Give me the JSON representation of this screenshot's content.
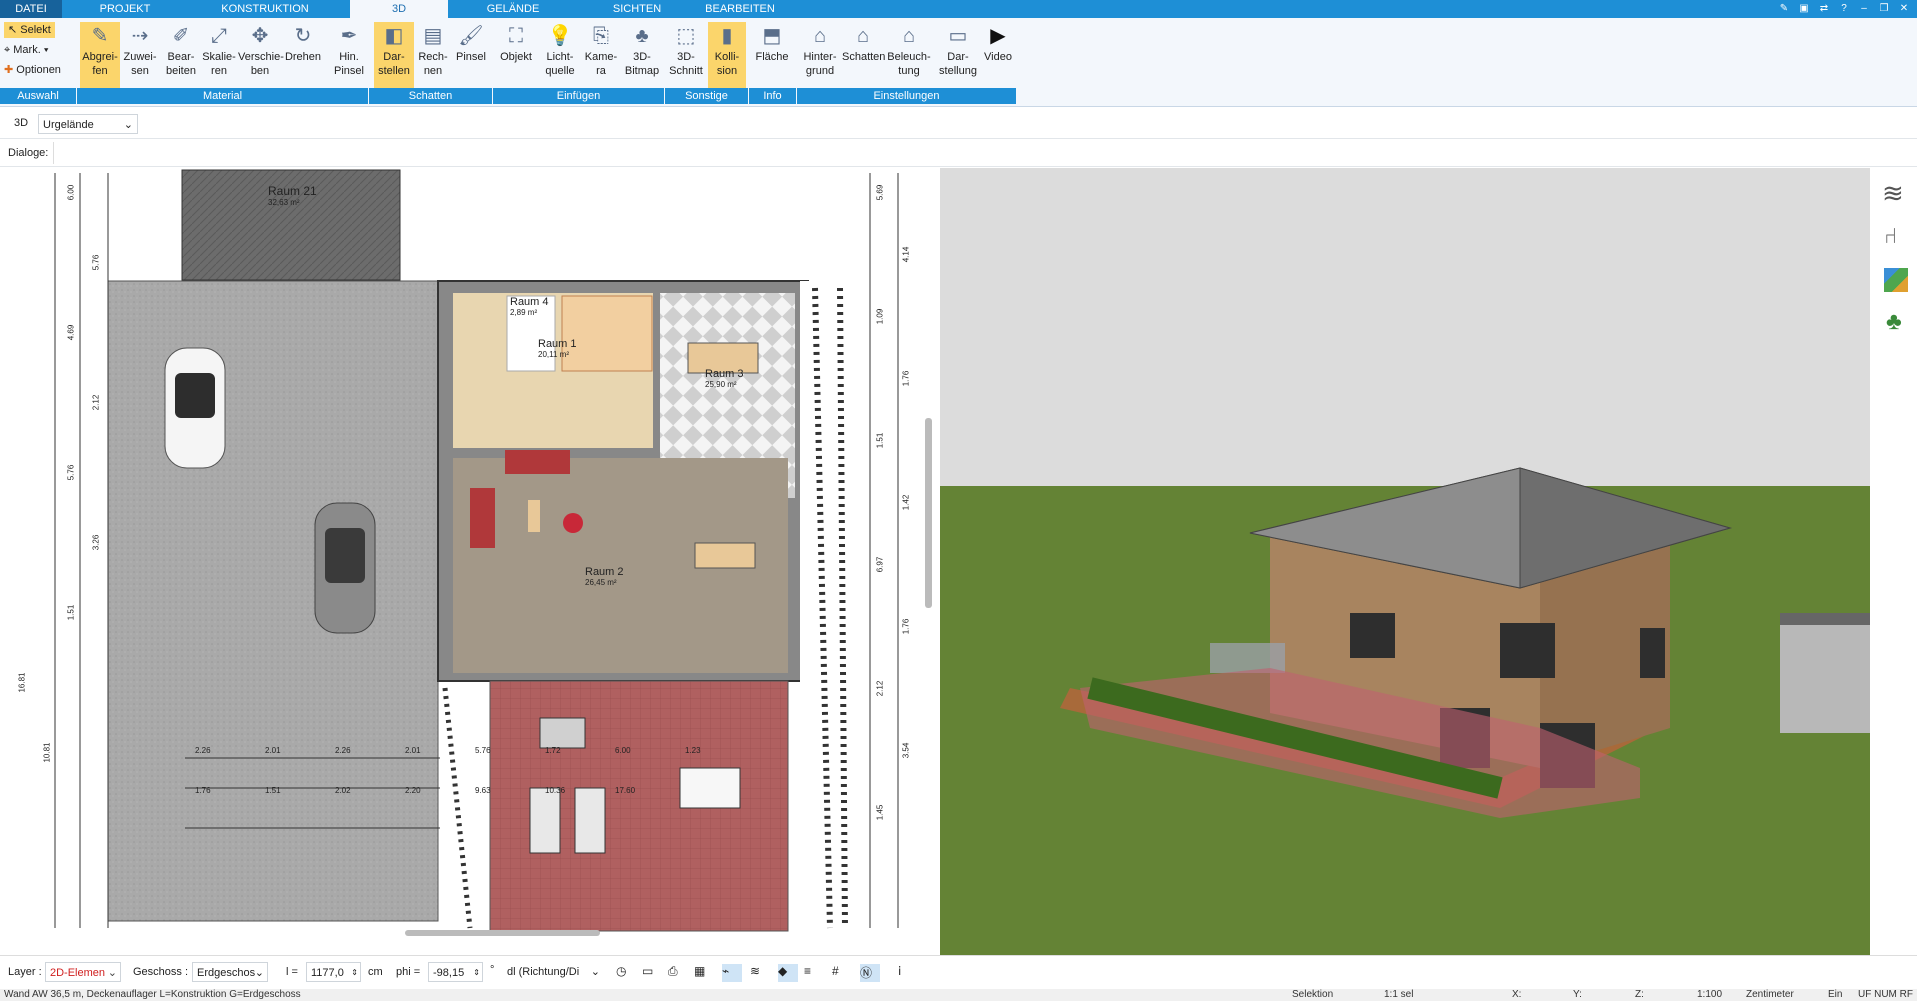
{
  "menu": {
    "tabs": [
      "DATEI",
      "PROJEKT",
      "KONSTRUKTION",
      "3D",
      "GELÄNDE",
      "SICHTEN",
      "BEARBEITEN"
    ]
  },
  "ribbon": {
    "selection": {
      "selekt": "Selekt",
      "mark": "Mark.",
      "optionen": "Optionen"
    },
    "buttons": [
      {
        "l1": "Abgrei-",
        "l2": "fen"
      },
      {
        "l1": "Zuwei-",
        "l2": "sen"
      },
      {
        "l1": "Bear-",
        "l2": "beiten"
      },
      {
        "l1": "Skalie-",
        "l2": "ren"
      },
      {
        "l1": "Verschie-",
        "l2": "ben"
      },
      {
        "l1": "Drehen",
        "l2": ""
      },
      {
        "l1": "Hin.",
        "l2": "Pinsel"
      },
      {
        "l1": "Dar-",
        "l2": "stellen"
      },
      {
        "l1": "Rech-",
        "l2": "nen"
      },
      {
        "l1": "Pinsel",
        "l2": ""
      },
      {
        "l1": "Objekt",
        "l2": ""
      },
      {
        "l1": "Licht-",
        "l2": "quelle"
      },
      {
        "l1": "Kame-",
        "l2": "ra"
      },
      {
        "l1": "3D-",
        "l2": "Bitmap"
      },
      {
        "l1": "3D-",
        "l2": "Schnitt"
      },
      {
        "l1": "Kolli-",
        "l2": "sion"
      },
      {
        "l1": "Fläche",
        "l2": ""
      },
      {
        "l1": "Hinter-",
        "l2": "grund"
      },
      {
        "l1": "Schatten",
        "l2": ""
      },
      {
        "l1": "Beleuch-",
        "l2": "tung"
      },
      {
        "l1": "Dar-",
        "l2": "stellung"
      },
      {
        "l1": "Video",
        "l2": ""
      }
    ],
    "groups": [
      "Auswahl",
      "Material",
      "Schatten",
      "Einfügen",
      "Sonstige",
      "Info",
      "Einstellungen"
    ]
  },
  "toolbar": {
    "mode": "3D",
    "terrain": "Urgelände",
    "dialoge": "Dialoge:"
  },
  "plan": {
    "rooms": [
      {
        "name": "Raum 21",
        "area": "32,63 m²"
      },
      {
        "name": "Raum 4",
        "area": "2,89 m²"
      },
      {
        "name": "Raum 1",
        "area": "20,11 m²"
      },
      {
        "name": "Raum 3",
        "area": "25,90 m²"
      },
      {
        "name": "Raum 2",
        "area": "26,45 m²"
      }
    ],
    "dims_left": [
      "6.00",
      "5.76",
      "4.69",
      "2.12",
      "5.76",
      "3.26",
      "1.51",
      "16.81",
      "10.81"
    ],
    "dims_bottom": [
      "2.26",
      "2.01",
      "2.26",
      "2.01",
      "5.76",
      "1.72",
      "6.00",
      "1.23",
      "1.76",
      "1.51",
      "2.02",
      "2.20",
      "9.63",
      "10.36",
      "17.60"
    ],
    "dims_right": [
      "5.69",
      "4.14",
      "1.09",
      "1.76",
      "1.51",
      "1.42",
      "6.97",
      "1.76",
      "2.12",
      "3.54",
      "1.45"
    ]
  },
  "bottombar": {
    "layer_label": "Layer :",
    "layer_value": "2D-Elemen",
    "geschoss_label": "Geschoss :",
    "geschoss_value": "Erdgeschos",
    "l_label": "l =",
    "l_value": "1177,0",
    "l_unit": "cm",
    "phi_label": "phi =",
    "phi_value": "-98,15",
    "phi_unit": "°",
    "dl_value": "dl (Richtung/Di"
  },
  "status": {
    "message": "Wand AW 36,5 m, Deckenauflager L=Konstruktion G=Erdgeschoss",
    "mode": "Selektion",
    "count": "1:1 sel",
    "x": "X:",
    "y": "Y:",
    "z": "Z:",
    "scale": "1:100",
    "unit": "Zentimeter",
    "ein": "Ein",
    "flags": "UF NUM RF"
  },
  "colors": {
    "accent": "#1e8fd6",
    "active": "#fbd56b",
    "grass": "#5f7f33",
    "red": "#b06060"
  }
}
